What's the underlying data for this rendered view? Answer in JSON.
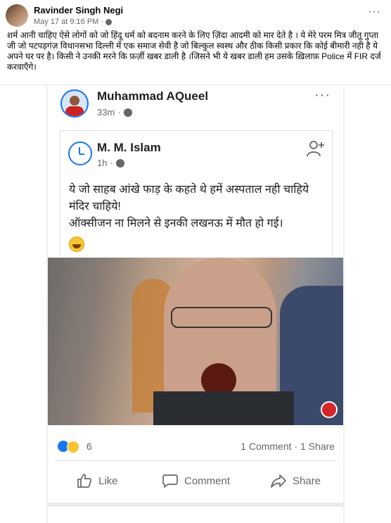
{
  "outer_post": {
    "author": "Ravinder Singh Negi",
    "timestamp": "May 17 at 9:16 PM",
    "meta_sep": "·",
    "menu": "···",
    "text": "शर्म आनी चाहिए ऐसे लोगों को जो हिंदू धर्म को बदनाम करने के लिए ज़िंदा आदमी को मार देते है । ये मेरे परम मित्र जीतू गुप्ता जी जो पटपड़गंज़ विधानसभा दिल्ली  में एक समाज सेवी है जो बिल्कुल स्वस्थ और ठीक किसी प्रकार कि कोई बीमारी नही है ये अपने घर पर  है। किसी ने उनकी मरने कि फ़र्ज़ी खबर डाली है ।जिसने भी ये खबर डाली हम उसके ख़िलाफ़ Police में FIR दर्ज करवाएँगे।"
  },
  "screenshot_post": {
    "author": "Muhammad AQueel",
    "time": "33m",
    "meta_sep": "·",
    "menu": "···",
    "shared_post": {
      "author": "M. M. Islam",
      "time": "1h",
      "meta_sep": "·",
      "text": "ये जो साहब आंखे फाड़ के कहते थे हमें अस्पताल नही चाहिये मंदिर चाहिये!\nऑक्सीजन ना मिलने से इनकी लखनऊ में मौत हो गई।"
    },
    "reactions": {
      "count": "6",
      "comments_shares": "1 Comment · 1 Share"
    },
    "actions": {
      "like": "Like",
      "comment": "Comment",
      "share": "Share"
    }
  },
  "icons": {
    "globe": "globe-icon",
    "add_friend": "add-friend-icon",
    "like": "thumbs-up-icon",
    "comment": "comment-bubble-icon",
    "share": "share-arrow-icon"
  },
  "colors": {
    "brand_blue": "#1877f2",
    "meta_gray": "#65676b"
  }
}
